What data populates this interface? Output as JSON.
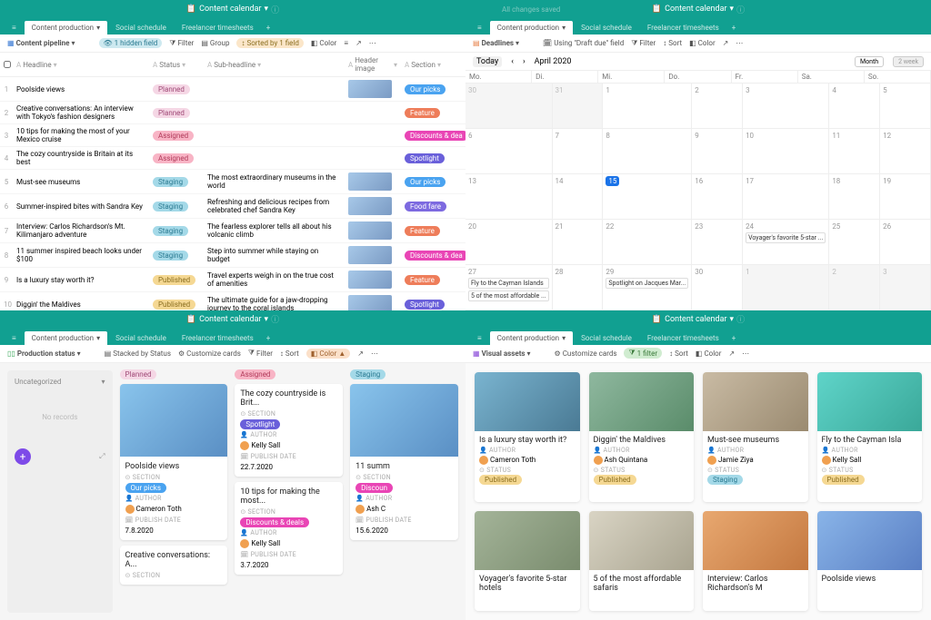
{
  "app_title": "Content calendar",
  "saved_status": "All changes saved",
  "tabs": [
    {
      "label": "Content production",
      "active": true
    },
    {
      "label": "Social schedule",
      "active": false
    },
    {
      "label": "Freelancer timesheets",
      "active": false
    }
  ],
  "q1": {
    "view_name": "Content pipeline",
    "toolbar": {
      "hidden": "1 hidden field",
      "filter": "Filter",
      "group": "Group",
      "sorted": "Sorted by 1 field",
      "color": "Color"
    },
    "columns": [
      "",
      "Headline",
      "Status",
      "Sub-headline",
      "Header image",
      "Section"
    ],
    "rows": [
      {
        "num": "1",
        "headline": "Poolside views",
        "status": "Planned",
        "status_class": "c-planned",
        "sub": "",
        "section": "Our picks",
        "section_class": "c-ourpicks",
        "img": true
      },
      {
        "num": "2",
        "headline": "Creative conversations: An interview with Tokyo's fashion designers",
        "status": "Planned",
        "status_class": "c-planned",
        "sub": "",
        "section": "Feature",
        "section_class": "c-feature",
        "img": false
      },
      {
        "num": "3",
        "headline": "10 tips for making the most of your Mexico cruise",
        "status": "Assigned",
        "status_class": "c-assigned",
        "sub": "",
        "section": "Discounts & dea",
        "section_class": "c-discounts",
        "img": false
      },
      {
        "num": "4",
        "headline": "The cozy countryside is Britain at its best",
        "status": "Assigned",
        "status_class": "c-assigned",
        "sub": "",
        "section": "Spotlight",
        "section_class": "c-spotlight",
        "img": false
      },
      {
        "num": "5",
        "headline": "Must-see museums",
        "status": "Staging",
        "status_class": "c-staging",
        "sub": "The most extraordinary museums in the world",
        "section": "Our picks",
        "section_class": "c-ourpicks",
        "img": true
      },
      {
        "num": "6",
        "headline": "Summer-inspired bites with Sandra Key",
        "status": "Staging",
        "status_class": "c-staging",
        "sub": "Refreshing and delicious recipes from celebrated chef Sandra Key",
        "section": "Food fare",
        "section_class": "c-foodfare",
        "img": true
      },
      {
        "num": "7",
        "headline": "Interview: Carlos Richardson's Mt. Kilimanjaro adventure",
        "status": "Staging",
        "status_class": "c-staging",
        "sub": "The fearless explorer tells all about his volcanic climb",
        "section": "Feature",
        "section_class": "c-feature",
        "img": true
      },
      {
        "num": "8",
        "headline": "11 summer inspired beach looks under $100",
        "status": "Staging",
        "status_class": "c-staging",
        "sub": "Step into summer while staying on budget",
        "section": "Discounts & dea",
        "section_class": "c-discounts",
        "img": true
      },
      {
        "num": "9",
        "headline": "Is a luxury stay worth it?",
        "status": "Published",
        "status_class": "c-published",
        "sub": "Travel experts weigh in on the true cost of amenities",
        "section": "Feature",
        "section_class": "c-feature",
        "img": true
      },
      {
        "num": "10",
        "headline": "Diggin' the Maldives",
        "status": "Published",
        "status_class": "c-published",
        "sub": "The ultimate guide for a jaw-dropping journey to the coral islands",
        "section": "Spotlight",
        "section_class": "c-spotlight",
        "img": true
      }
    ]
  },
  "q2": {
    "view_name": "Deadlines",
    "toolbar": {
      "using": "Using \"Draft due\" field",
      "filter": "Filter",
      "sort": "Sort",
      "color": "Color"
    },
    "today_btn": "Today",
    "month_label": "April 2020",
    "mode_month": "Month",
    "mode_2week": "2 week",
    "days": [
      "Mo.",
      "Di.",
      "Mi.",
      "Do.",
      "Fr.",
      "Sa.",
      "So."
    ],
    "cells": [
      {
        "n": "30",
        "other": true
      },
      {
        "n": "31",
        "other": true
      },
      {
        "n": "1"
      },
      {
        "n": "2"
      },
      {
        "n": "3"
      },
      {
        "n": "4"
      },
      {
        "n": "5"
      },
      {
        "n": "6"
      },
      {
        "n": "7"
      },
      {
        "n": "8"
      },
      {
        "n": "9"
      },
      {
        "n": "10"
      },
      {
        "n": "11"
      },
      {
        "n": "12"
      },
      {
        "n": "13"
      },
      {
        "n": "14"
      },
      {
        "n": "15",
        "today": true
      },
      {
        "n": "16"
      },
      {
        "n": "17"
      },
      {
        "n": "18"
      },
      {
        "n": "19"
      },
      {
        "n": "20"
      },
      {
        "n": "21"
      },
      {
        "n": "22"
      },
      {
        "n": "23"
      },
      {
        "n": "24",
        "events": [
          "Voyager's favorite 5-star ..."
        ]
      },
      {
        "n": "25"
      },
      {
        "n": "26"
      },
      {
        "n": "27",
        "events": [
          "Fly to the Cayman Islands",
          "5 of the most affordable ..."
        ]
      },
      {
        "n": "28"
      },
      {
        "n": "29",
        "events": [
          "Spotlight on Jacques Mar..."
        ]
      },
      {
        "n": "30"
      },
      {
        "n": "1",
        "other": true
      },
      {
        "n": "2",
        "other": true
      },
      {
        "n": "3",
        "other": true
      }
    ]
  },
  "q3": {
    "view_name": "Production status",
    "toolbar": {
      "stacked": "Stacked by Status",
      "customize": "Customize cards",
      "filter": "Filter",
      "sort": "Sort",
      "color": "Color"
    },
    "uncategorized": {
      "label": "Uncategorized",
      "empty": "No records"
    },
    "columns": [
      {
        "name": "Planned",
        "name_class": "c-planned",
        "cards": [
          {
            "title": "Poolside views",
            "section": "Our picks",
            "section_class": "c-ourpicks",
            "author": "Cameron Toth",
            "date": "7.8.2020",
            "img": true
          },
          {
            "title": "Creative conversations: A...",
            "section": "",
            "section_class": "",
            "author": "",
            "date": "",
            "img": false,
            "brief": true
          }
        ]
      },
      {
        "name": "Assigned",
        "name_class": "c-assigned",
        "cards": [
          {
            "title": "The cozy countryside is Brit...",
            "section": "Spotlight",
            "section_class": "c-spotlight",
            "author": "Kelly Sall",
            "date": "22.7.2020",
            "img": false
          },
          {
            "title": "10 tips for making the most...",
            "section": "Discounts & deals",
            "section_class": "c-discounts",
            "author": "Kelly Sall",
            "date": "3.7.2020",
            "img": false
          }
        ]
      },
      {
        "name": "Staging",
        "name_class": "c-staging",
        "cards": [
          {
            "title": "11 summ",
            "section": "Discoun",
            "section_class": "c-discounts",
            "author": "Ash C",
            "date": "15.6.2020",
            "img": true,
            "partial": true
          }
        ]
      }
    ],
    "labels": {
      "section": "SECTION",
      "author": "AUTHOR",
      "publish": "PUBLISH DATE"
    }
  },
  "q4": {
    "view_name": "Visual assets",
    "toolbar": {
      "customize": "Customize cards",
      "filter": "1 filter",
      "sort": "Sort",
      "color": "Color"
    },
    "labels": {
      "author": "AUTHOR",
      "status": "STATUS"
    },
    "cards": [
      {
        "title": "Is a luxury stay worth it?",
        "author": "Cameron Toth",
        "status": "Published",
        "status_class": "c-published",
        "grad": "linear-gradient(135deg,#7ab4d0,#4a7a94)"
      },
      {
        "title": "Diggin' the Maldives",
        "author": "Ash Quintana",
        "status": "Published",
        "status_class": "c-published",
        "grad": "linear-gradient(135deg,#8fb89f,#5a8c6a)"
      },
      {
        "title": "Must-see museums",
        "author": "Jamie Ziya",
        "status": "Staging",
        "status_class": "c-staging",
        "grad": "linear-gradient(135deg,#c9bba4,#9a8a70)"
      },
      {
        "title": "Fly to the Cayman Isla",
        "author": "Kelly Sall",
        "status": "Published",
        "status_class": "c-published",
        "grad": "linear-gradient(135deg,#5fd4c9,#3aa899)"
      },
      {
        "title": "Voyager's favorite 5-star hotels",
        "author": "",
        "status": "",
        "status_class": "",
        "grad": "linear-gradient(135deg,#a4b499,#7a8c6e)",
        "brief": true
      },
      {
        "title": "5 of the most affordable safaris",
        "author": "",
        "status": "",
        "status_class": "",
        "grad": "linear-gradient(135deg,#d9d4c4,#a9a490)",
        "brief": true
      },
      {
        "title": "Interview: Carlos Richardson's M",
        "author": "",
        "status": "",
        "status_class": "",
        "grad": "linear-gradient(135deg,#e8a870,#c47840)",
        "brief": true
      },
      {
        "title": "Poolside views",
        "author": "",
        "status": "",
        "status_class": "",
        "grad": "linear-gradient(135deg,#89b4e8,#5a7fc4)",
        "brief": true
      }
    ]
  }
}
